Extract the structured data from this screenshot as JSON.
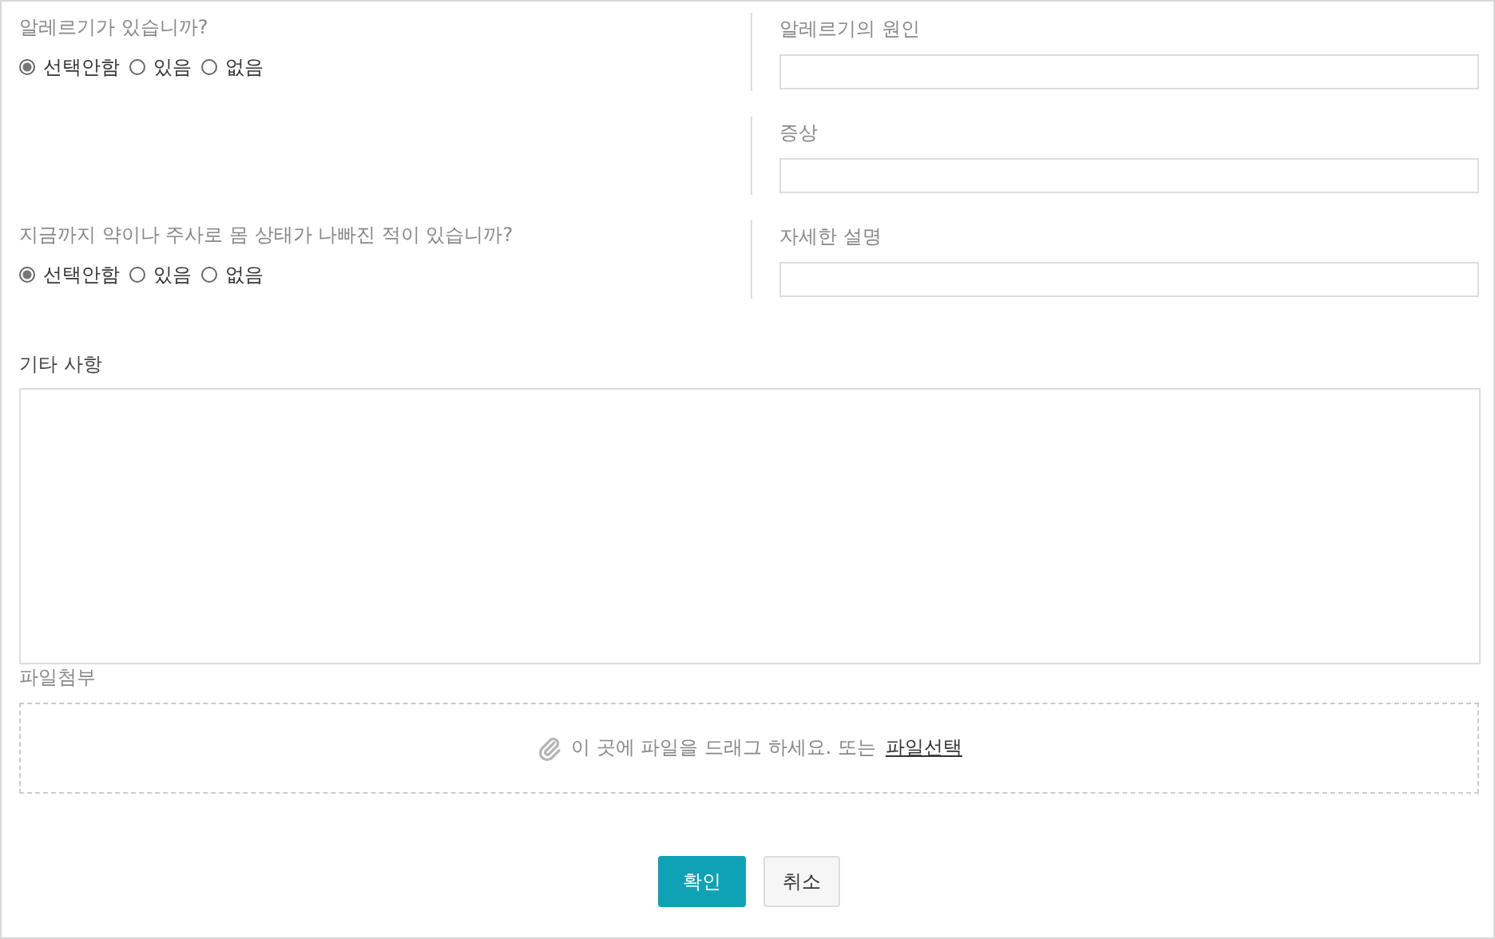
{
  "rows": [
    {
      "question": {
        "label": "알레르기가 있습니까?",
        "options": [
          {
            "label": "선택안함",
            "selected": true
          },
          {
            "label": "있음",
            "selected": false
          },
          {
            "label": "없음",
            "selected": false
          }
        ]
      },
      "field": {
        "label": "알레르기의 원인"
      }
    },
    {
      "field": {
        "label": "증상"
      }
    },
    {
      "question": {
        "label": "지금까지 약이나 주사로 몸 상태가 나빠진 적이 있습니까?",
        "options": [
          {
            "label": "선택안함",
            "selected": true
          },
          {
            "label": "있음",
            "selected": false
          },
          {
            "label": "없음",
            "selected": false
          }
        ]
      },
      "field": {
        "label": "자세한 설명"
      }
    }
  ],
  "notes": {
    "label": "기타 사항"
  },
  "attachment": {
    "label": "파일첨부",
    "hint": "이 곳에 파일을 드래그 하세요. 또는",
    "link": "파일선택"
  },
  "buttons": [
    {
      "label": "확인",
      "kind": "primary"
    },
    {
      "label": "취소",
      "kind": "secondary"
    }
  ]
}
